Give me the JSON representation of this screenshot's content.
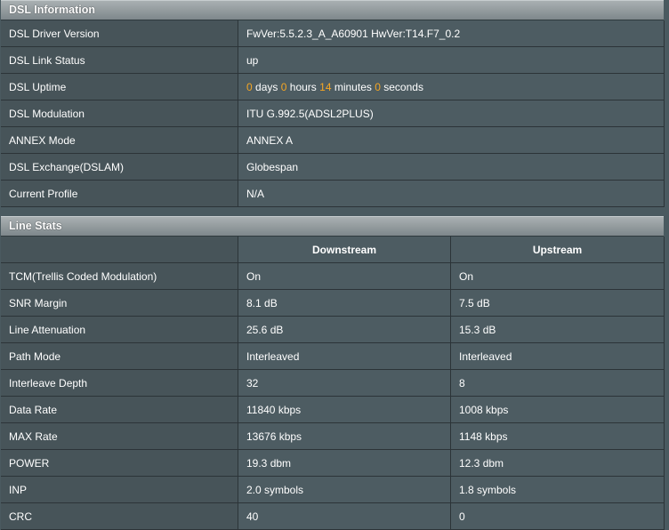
{
  "dsl_info": {
    "title": "DSL Information",
    "rows": [
      {
        "label": "DSL Driver Version",
        "value": "FwVer:5.5.2.3_A_A60901 HwVer:T14.F7_0.2"
      },
      {
        "label": "DSL Link Status",
        "value": "up"
      },
      {
        "label": "DSL Uptime"
      },
      {
        "label": "DSL Modulation",
        "value": "ITU G.992.5(ADSL2PLUS)"
      },
      {
        "label": "ANNEX Mode",
        "value": "ANNEX A"
      },
      {
        "label": "DSL Exchange(DSLAM)",
        "value": "Globespan"
      },
      {
        "label": "Current Profile",
        "value": "N/A"
      }
    ],
    "uptime": {
      "days": "0",
      "days_unit": "days",
      "hours": "0",
      "hours_unit": "hours",
      "minutes": "14",
      "minutes_unit": "minutes",
      "seconds": "0",
      "seconds_unit": "seconds"
    }
  },
  "line_stats": {
    "title": "Line Stats",
    "columns": {
      "downstream": "Downstream",
      "upstream": "Upstream"
    },
    "rows": [
      {
        "label": "TCM(Trellis Coded Modulation)",
        "down": "On",
        "up": "On"
      },
      {
        "label": "SNR Margin",
        "down": "8.1 dB",
        "up": "7.5 dB"
      },
      {
        "label": "Line Attenuation",
        "down": "25.6 dB",
        "up": "15.3 dB"
      },
      {
        "label": "Path Mode",
        "down": "Interleaved",
        "up": "Interleaved"
      },
      {
        "label": "Interleave Depth",
        "down": "32",
        "up": "8"
      },
      {
        "label": "Data Rate",
        "down": "11840 kbps",
        "up": "1008 kbps"
      },
      {
        "label": "MAX Rate",
        "down": "13676 kbps",
        "up": "1148 kbps"
      },
      {
        "label": "POWER",
        "down": "19.3 dbm",
        "up": "12.3 dbm"
      },
      {
        "label": "INP",
        "down": "2.0 symbols",
        "up": "1.8 symbols"
      },
      {
        "label": "CRC",
        "down": "40",
        "up": "0"
      }
    ]
  },
  "colors": {
    "highlight": "#f5a623",
    "background": "#4a5a60"
  }
}
